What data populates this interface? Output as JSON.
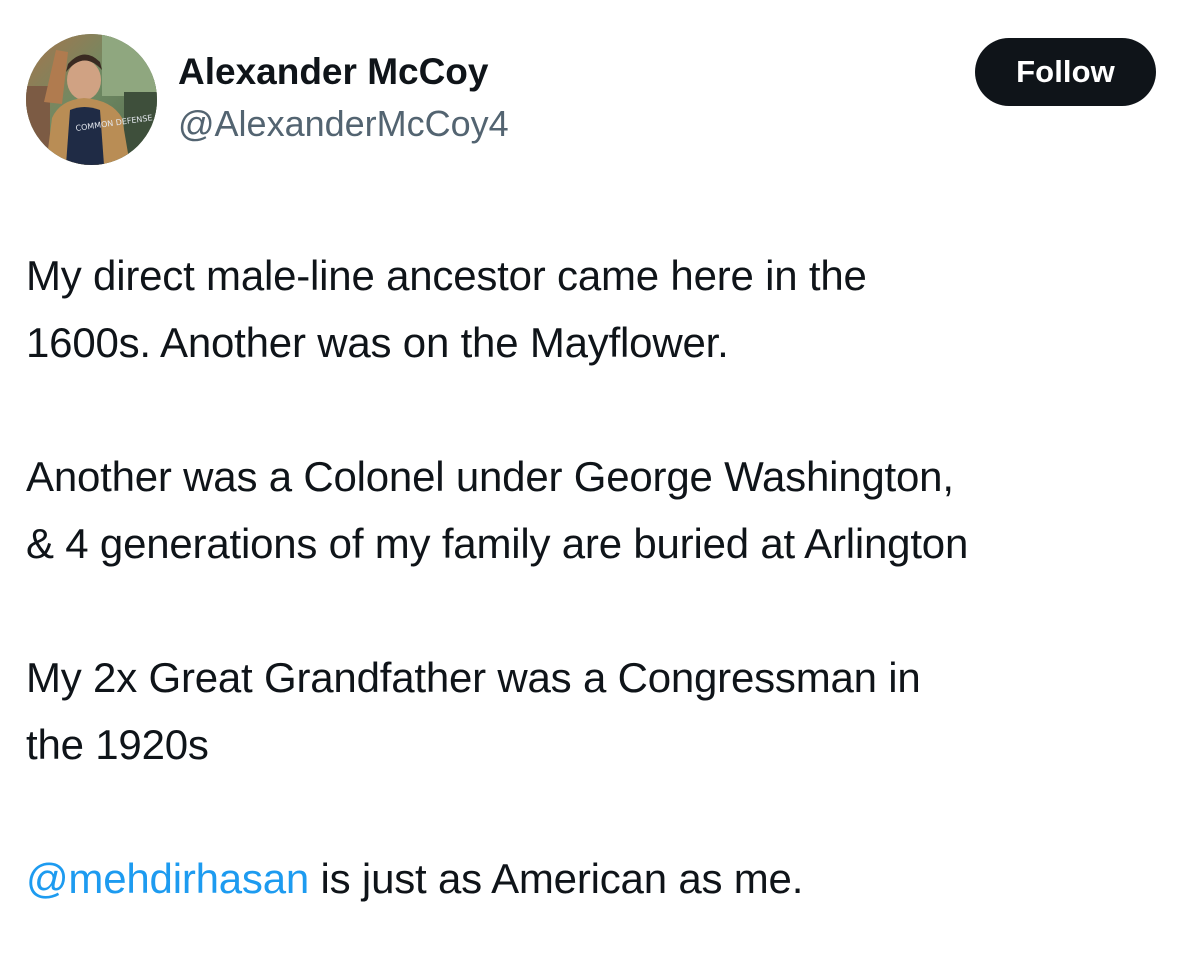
{
  "author": {
    "display_name": "Alexander McCoy",
    "handle": "@AlexanderMcCoy4",
    "avatar_icon": "profile-photo",
    "avatar_shirt_text": "COMMON DEFENSE"
  },
  "actions": {
    "follow_label": "Follow"
  },
  "tweet": {
    "paragraphs": [
      {
        "lines": [
          "My direct male-line ancestor came here in the",
          "1600s. Another was on the Mayflower."
        ]
      },
      {
        "lines": [
          "Another was a Colonel under George Washington,",
          "& 4 generations of my family are buried at Arlington"
        ]
      },
      {
        "lines": [
          "My 2x Great Grandfather was a Congressman in",
          "the 1920s"
        ]
      }
    ],
    "closing": {
      "mention": "@mehdirhasan",
      "text": " is just as American as me."
    }
  },
  "colors": {
    "text": "#0f1419",
    "secondary_text": "#536471",
    "link": "#1d9bf0",
    "button_bg": "#0f1419",
    "button_text": "#ffffff",
    "background": "#ffffff"
  }
}
